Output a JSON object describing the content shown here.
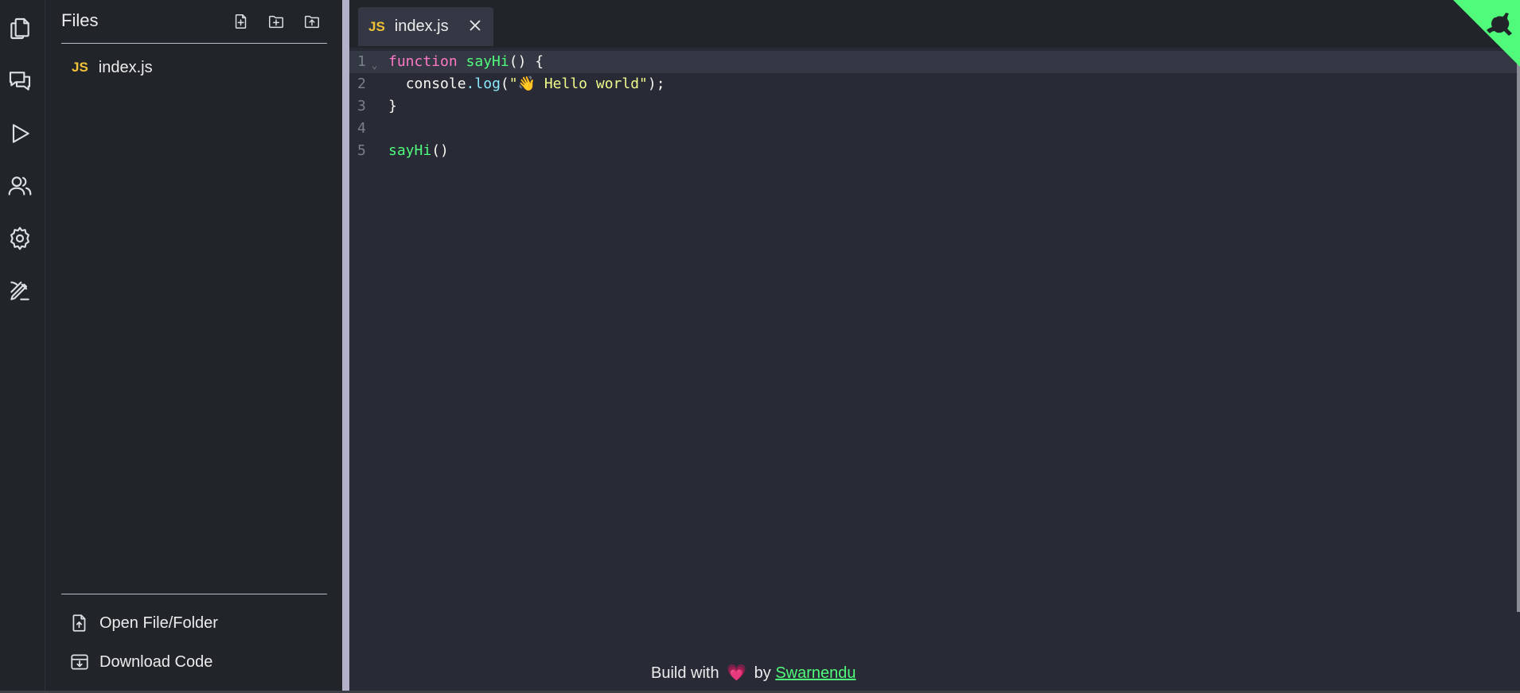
{
  "sidebar": {
    "title": "Files",
    "files": [
      {
        "badge": "JS",
        "name": "index.js"
      }
    ],
    "footer": {
      "open_label": "Open File/Folder",
      "download_label": "Download Code"
    }
  },
  "editor": {
    "tab": {
      "badge": "JS",
      "label": "index.js"
    },
    "lines": [
      {
        "number": "1"
      },
      {
        "number": "2"
      },
      {
        "number": "3"
      },
      {
        "number": "4"
      },
      {
        "number": "5"
      }
    ],
    "code": {
      "line1": {
        "kw": "function",
        "fn": "sayHi",
        "rest": "() {"
      },
      "line2": {
        "obj": "console",
        "dot": ".",
        "method": "log",
        "open": "(",
        "string": "\"👋 Hello world\"",
        "close": ");"
      },
      "line3": {
        "text": "}"
      },
      "line5": {
        "fn": "sayHi",
        "rest": "()"
      }
    }
  },
  "credit": {
    "prefix": "Build with",
    "heart": "💗",
    "by": "by",
    "author": "Swarnendu"
  },
  "colors": {
    "accent": "#50fa7b",
    "js_badge": "#f0c239",
    "keyword": "#ff79c6",
    "string": "#f1fa8c",
    "property": "#8be9fd"
  }
}
